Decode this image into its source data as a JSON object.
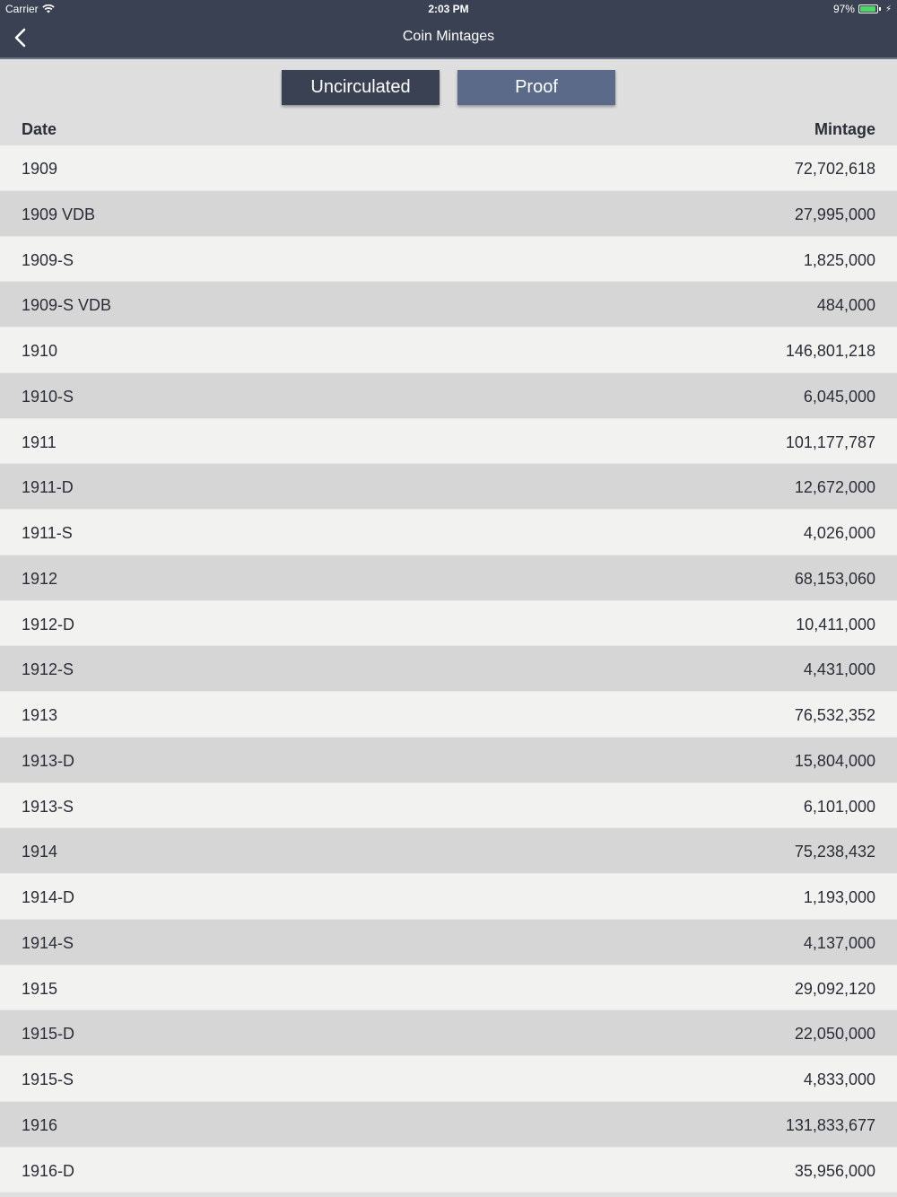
{
  "status_bar": {
    "carrier": "Carrier",
    "time": "2:03 PM",
    "battery": "97%",
    "battery_level": 0.97
  },
  "nav": {
    "title": "Coin Mintages",
    "back_icon": "chevron-left-icon"
  },
  "segments": {
    "uncirculated_label": "Uncirculated",
    "proof_label": "Proof",
    "selected": "Uncirculated"
  },
  "table": {
    "headers": {
      "date": "Date",
      "mintage": "Mintage"
    },
    "rows": [
      {
        "date": "1909",
        "mintage": "72,702,618"
      },
      {
        "date": "1909 VDB",
        "mintage": "27,995,000"
      },
      {
        "date": "1909-S",
        "mintage": "1,825,000"
      },
      {
        "date": "1909-S VDB",
        "mintage": "484,000"
      },
      {
        "date": "1910",
        "mintage": "146,801,218"
      },
      {
        "date": "1910-S",
        "mintage": "6,045,000"
      },
      {
        "date": "1911",
        "mintage": "101,177,787"
      },
      {
        "date": "1911-D",
        "mintage": "12,672,000"
      },
      {
        "date": "1911-S",
        "mintage": "4,026,000"
      },
      {
        "date": "1912",
        "mintage": "68,153,060"
      },
      {
        "date": "1912-D",
        "mintage": "10,411,000"
      },
      {
        "date": "1912-S",
        "mintage": "4,431,000"
      },
      {
        "date": "1913",
        "mintage": "76,532,352"
      },
      {
        "date": "1913-D",
        "mintage": "15,804,000"
      },
      {
        "date": "1913-S",
        "mintage": "6,101,000"
      },
      {
        "date": "1914",
        "mintage": "75,238,432"
      },
      {
        "date": "1914-D",
        "mintage": "1,193,000"
      },
      {
        "date": "1914-S",
        "mintage": "4,137,000"
      },
      {
        "date": "1915",
        "mintage": "29,092,120"
      },
      {
        "date": "1915-D",
        "mintage": "22,050,000"
      },
      {
        "date": "1915-S",
        "mintage": "4,833,000"
      },
      {
        "date": "1916",
        "mintage": "131,833,677"
      },
      {
        "date": "1916-D",
        "mintage": "35,956,000"
      }
    ]
  },
  "colors": {
    "nav_background": "#3a4152",
    "segment_selected": "#3a4152",
    "segment_unselected": "#5a6a88",
    "row_light": "#f2f2f0",
    "row_dark": "#d6d6d6",
    "text": "#2b2e38",
    "battery": "#4cd964"
  }
}
